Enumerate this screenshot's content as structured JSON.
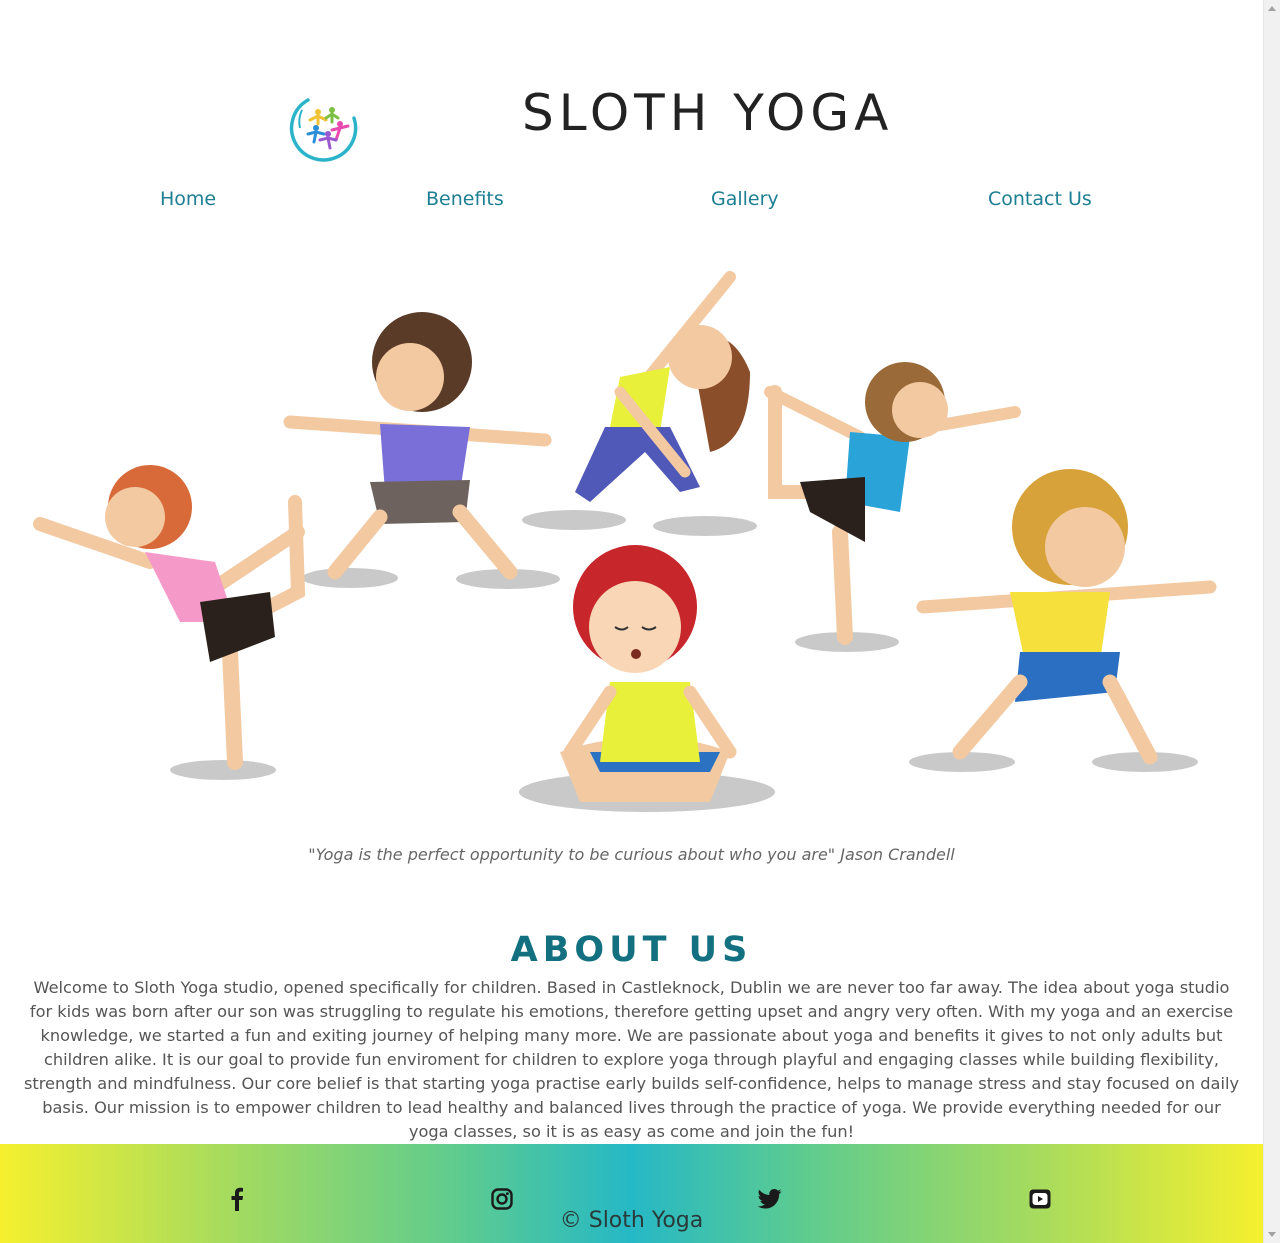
{
  "header": {
    "brand": "SLOTH YOGA",
    "logo_icon": "yoga-people-circle-logo"
  },
  "nav": {
    "items": [
      {
        "label": "Home"
      },
      {
        "label": "Benefits"
      },
      {
        "label": "Gallery"
      },
      {
        "label": "Contact Us"
      }
    ]
  },
  "hero": {
    "image_description_icon": "kids-doing-yoga-illustration"
  },
  "quote": {
    "text": "\"Yoga is the perfect opportunity to be curious about who you are\" Jason Crandell"
  },
  "about": {
    "title": "ABOUT US",
    "body": "Welcome to Sloth Yoga studio, opened specifically for children. Based in Castleknock, Dublin we are never too far away. The idea about yoga studio for kids was born after our son was struggling to regulate his emotions, therefore getting upset and angry very often. With my yoga and an exercise knowledge, we started a fun and exiting journey of helping many more. We are passionate about yoga and benefits it gives to not only adults but children alike. It is our goal to provide fun enviroment for children to explore yoga through playful and engaging classes while building flexibility, strength and mindfulness. Our core belief is that starting yoga practise early builds self-confidence, helps to manage stress and stay focused on daily basis. Our mission is to empower children to lead healthy and balanced lives through the practice of yoga. We provide everything needed for our yoga classes, so it is as easy as come and join the fun!"
  },
  "footer": {
    "social": [
      {
        "icon": "facebook-icon"
      },
      {
        "icon": "instagram-icon"
      },
      {
        "icon": "twitter-icon"
      },
      {
        "icon": "youtube-icon"
      }
    ],
    "copyright": "© Sloth Yoga"
  },
  "colors": {
    "nav_link": "#1d7f93",
    "about_title": "#137080",
    "footer_gradient_center": "#25b8c6",
    "footer_gradient_edge": "#f5f02e"
  }
}
